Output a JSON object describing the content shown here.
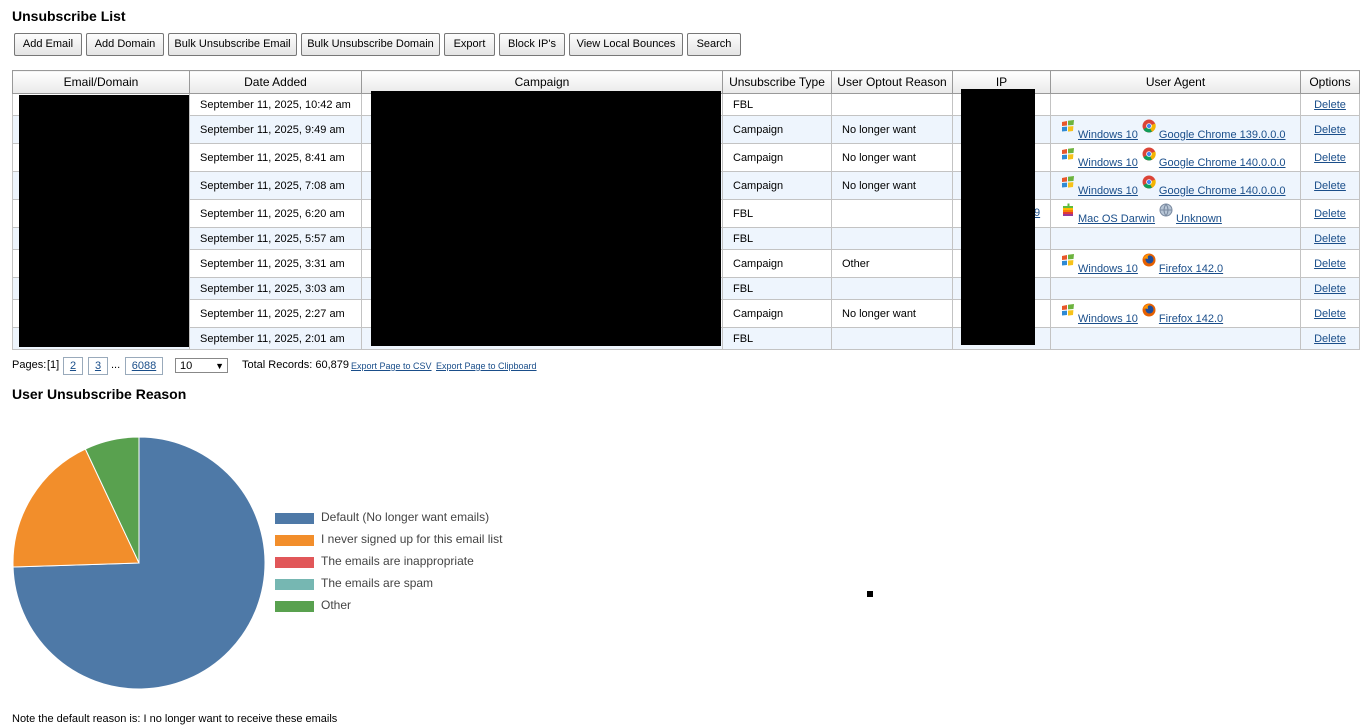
{
  "page": {
    "title": "Unsubscribe List",
    "section_title": "User Unsubscribe Reason",
    "note": "Note the default reason is: I no longer want to receive these emails"
  },
  "toolbar": {
    "buttons": [
      "Add Email",
      "Add Domain",
      "Bulk Unsubscribe Email",
      "Bulk Unsubscribe Domain",
      "Export",
      "Block IP's",
      "View Local Bounces",
      "Search"
    ]
  },
  "table": {
    "headers": [
      "Email/Domain",
      "Date Added",
      "Campaign",
      "Unsubscribe Type",
      "User Optout Reason",
      "IP",
      "User Agent",
      "Options"
    ],
    "rows": [
      {
        "date": "September 11, 2025, 10:42 am",
        "type": "FBL",
        "reason": "",
        "ip_tail": "",
        "os": "",
        "browser": "",
        "delete": "Delete"
      },
      {
        "date": "September 11, 2025, 9:49 am",
        "type": "Campaign",
        "reason": "No longer want",
        "ip_tail": "",
        "os": "Windows 10",
        "os_icon": "windows-icon",
        "browser": "Google Chrome 139.0.0.0",
        "browser_icon": "chrome-icon",
        "delete": "Delete"
      },
      {
        "date": "September 11, 2025, 8:41 am",
        "type": "Campaign",
        "reason": "No longer want",
        "ip_tail": "",
        "os": "Windows 10",
        "os_icon": "windows-icon",
        "browser": "Google Chrome 140.0.0.0",
        "browser_icon": "chrome-icon",
        "delete": "Delete"
      },
      {
        "date": "September 11, 2025, 7:08 am",
        "type": "Campaign",
        "reason": "No longer want",
        "ip_tail": "",
        "os": "Windows 10",
        "os_icon": "windows-icon",
        "browser": "Google Chrome 140.0.0.0",
        "browser_icon": "chrome-icon",
        "delete": "Delete"
      },
      {
        "date": "September 11, 2025, 6:20 am",
        "type": "FBL",
        "reason": "",
        "ip_tail": "9",
        "os": "Mac OS Darwin",
        "os_icon": "apple-icon",
        "browser": "Unknown",
        "browser_icon": "globe-icon",
        "delete": "Delete"
      },
      {
        "date": "September 11, 2025, 5:57 am",
        "type": "FBL",
        "reason": "",
        "ip_tail": "",
        "os": "",
        "browser": "",
        "delete": "Delete"
      },
      {
        "date": "September 11, 2025, 3:31 am",
        "type": "Campaign",
        "reason": "Other",
        "ip_tail": "",
        "os": "Windows 10",
        "os_icon": "windows-icon",
        "browser": "Firefox 142.0",
        "browser_icon": "firefox-icon",
        "delete": "Delete"
      },
      {
        "date": "September 11, 2025, 3:03 am",
        "type": "FBL",
        "reason": "",
        "ip_tail": "",
        "os": "",
        "browser": "",
        "delete": "Delete"
      },
      {
        "date": "September 11, 2025, 2:27 am",
        "type": "Campaign",
        "reason": "No longer want",
        "ip_tail": "",
        "os": "Windows 10",
        "os_icon": "windows-icon",
        "browser": "Firefox 142.0",
        "browser_icon": "firefox-icon",
        "delete": "Delete"
      },
      {
        "date": "September 11, 2025, 2:01 am",
        "type": "FBL",
        "reason": "",
        "ip_tail": "",
        "os": "",
        "browser": "",
        "delete": "Delete"
      }
    ]
  },
  "pager": {
    "label": "Pages:",
    "current": "[1]",
    "pages": [
      "2",
      "3"
    ],
    "ellipsis": "...",
    "last": "6088",
    "per_page": "10",
    "total": "Total Records: 60,879",
    "export_csv": "Export Page to CSV",
    "export_clip": "Export Page to Clipboard"
  },
  "chart_data": {
    "type": "pie",
    "title": "",
    "series": [
      {
        "name": "Default (No longer want emails)",
        "value": 74.5,
        "color": "#4e79a7"
      },
      {
        "name": "I never signed up for this email list",
        "value": 18.5,
        "color": "#f28e2b"
      },
      {
        "name": "The emails are inappropriate",
        "value": 0,
        "color": "#e15759"
      },
      {
        "name": "The emails are spam",
        "value": 0,
        "color": "#76b7b2"
      },
      {
        "name": "Other",
        "value": 7.0,
        "color": "#59a14f"
      }
    ],
    "legend_position": "right"
  }
}
